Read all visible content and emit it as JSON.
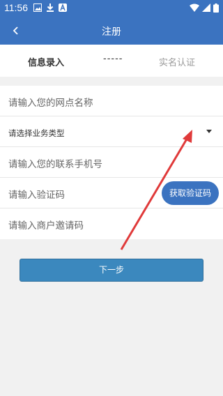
{
  "status": {
    "time": "11:56"
  },
  "nav": {
    "title": "注册",
    "back_icon": "back-chevron-icon"
  },
  "steps": {
    "step1": "信息录入",
    "separator": "-----",
    "step2": "实名认证"
  },
  "form": {
    "shop_name_placeholder": "请输入您的网点名称",
    "business_type_placeholder": "请选择业务类型",
    "phone_placeholder": "请输入您的联系手机号",
    "code_placeholder": "请输入验证码",
    "get_code_label": "获取验证码",
    "invite_placeholder": "请输入商户邀请码"
  },
  "next_label": "下一步",
  "colors": {
    "primary": "#3b73c0",
    "annotation_arrow": "#e03a3a"
  }
}
